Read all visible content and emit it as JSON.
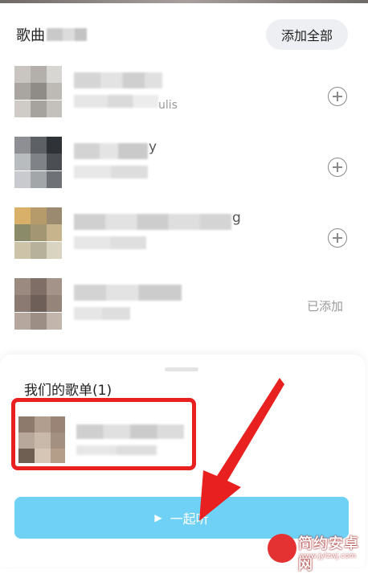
{
  "header": {
    "title": "歌曲",
    "add_all_label": "添加全部"
  },
  "songs": [
    {
      "title_suffix": "",
      "subtitle_suffix": "ulis",
      "action": "add"
    },
    {
      "title_suffix": "y",
      "subtitle_suffix": "",
      "action": "add"
    },
    {
      "title_suffix": "g",
      "subtitle_suffix": "",
      "action": "add"
    },
    {
      "title_suffix": "",
      "subtitle_suffix": "",
      "action": "added",
      "added_label": "已添加"
    }
  ],
  "sheet": {
    "title": "我们的歌单(1)",
    "listen_icon": "▶",
    "listen_label": "一起听"
  },
  "watermark": {
    "name": "简约安卓网",
    "url": "www.jylzwj.com"
  },
  "colors": {
    "accent_button": "#6fd1f5",
    "highlight_red": "#e8201f",
    "plus_icon": "#888888"
  }
}
